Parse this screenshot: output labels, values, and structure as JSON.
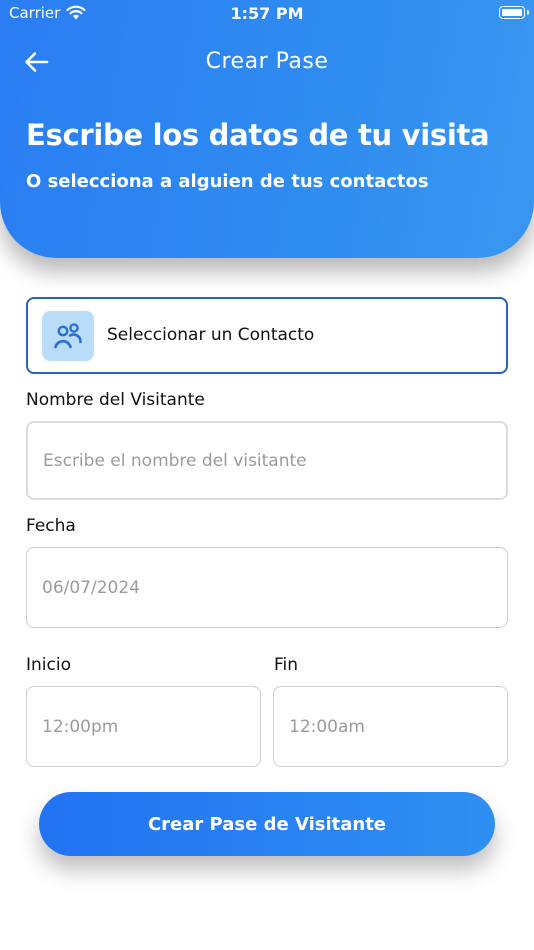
{
  "status_bar": {
    "carrier": "Carrier",
    "time": "1:57 PM"
  },
  "header": {
    "nav_title": "Crear Pase",
    "title": "Escribe los datos de tu visita",
    "subtitle": "O selecciona a alguien de tus contactos"
  },
  "contact": {
    "label": "Seleccionar un Contacto"
  },
  "form": {
    "visitor_label": "Nombre del Visitante",
    "visitor_placeholder": "Escribe el nombre del visitante",
    "date_label": "Fecha",
    "date_value": "06/07/2024",
    "start_label": "Inicio",
    "start_value": "12:00pm",
    "end_label": "Fin",
    "end_value": "12:00am"
  },
  "submit_label": "Crear Pase de Visitante",
  "colors": {
    "primary": "#2a7df2",
    "contact_border": "#2d62b5",
    "icon_bg": "#b9ddf9"
  },
  "icons": {
    "back": "arrow-left-icon",
    "contacts": "people-icon",
    "wifi": "wifi-icon",
    "battery": "battery-icon"
  }
}
